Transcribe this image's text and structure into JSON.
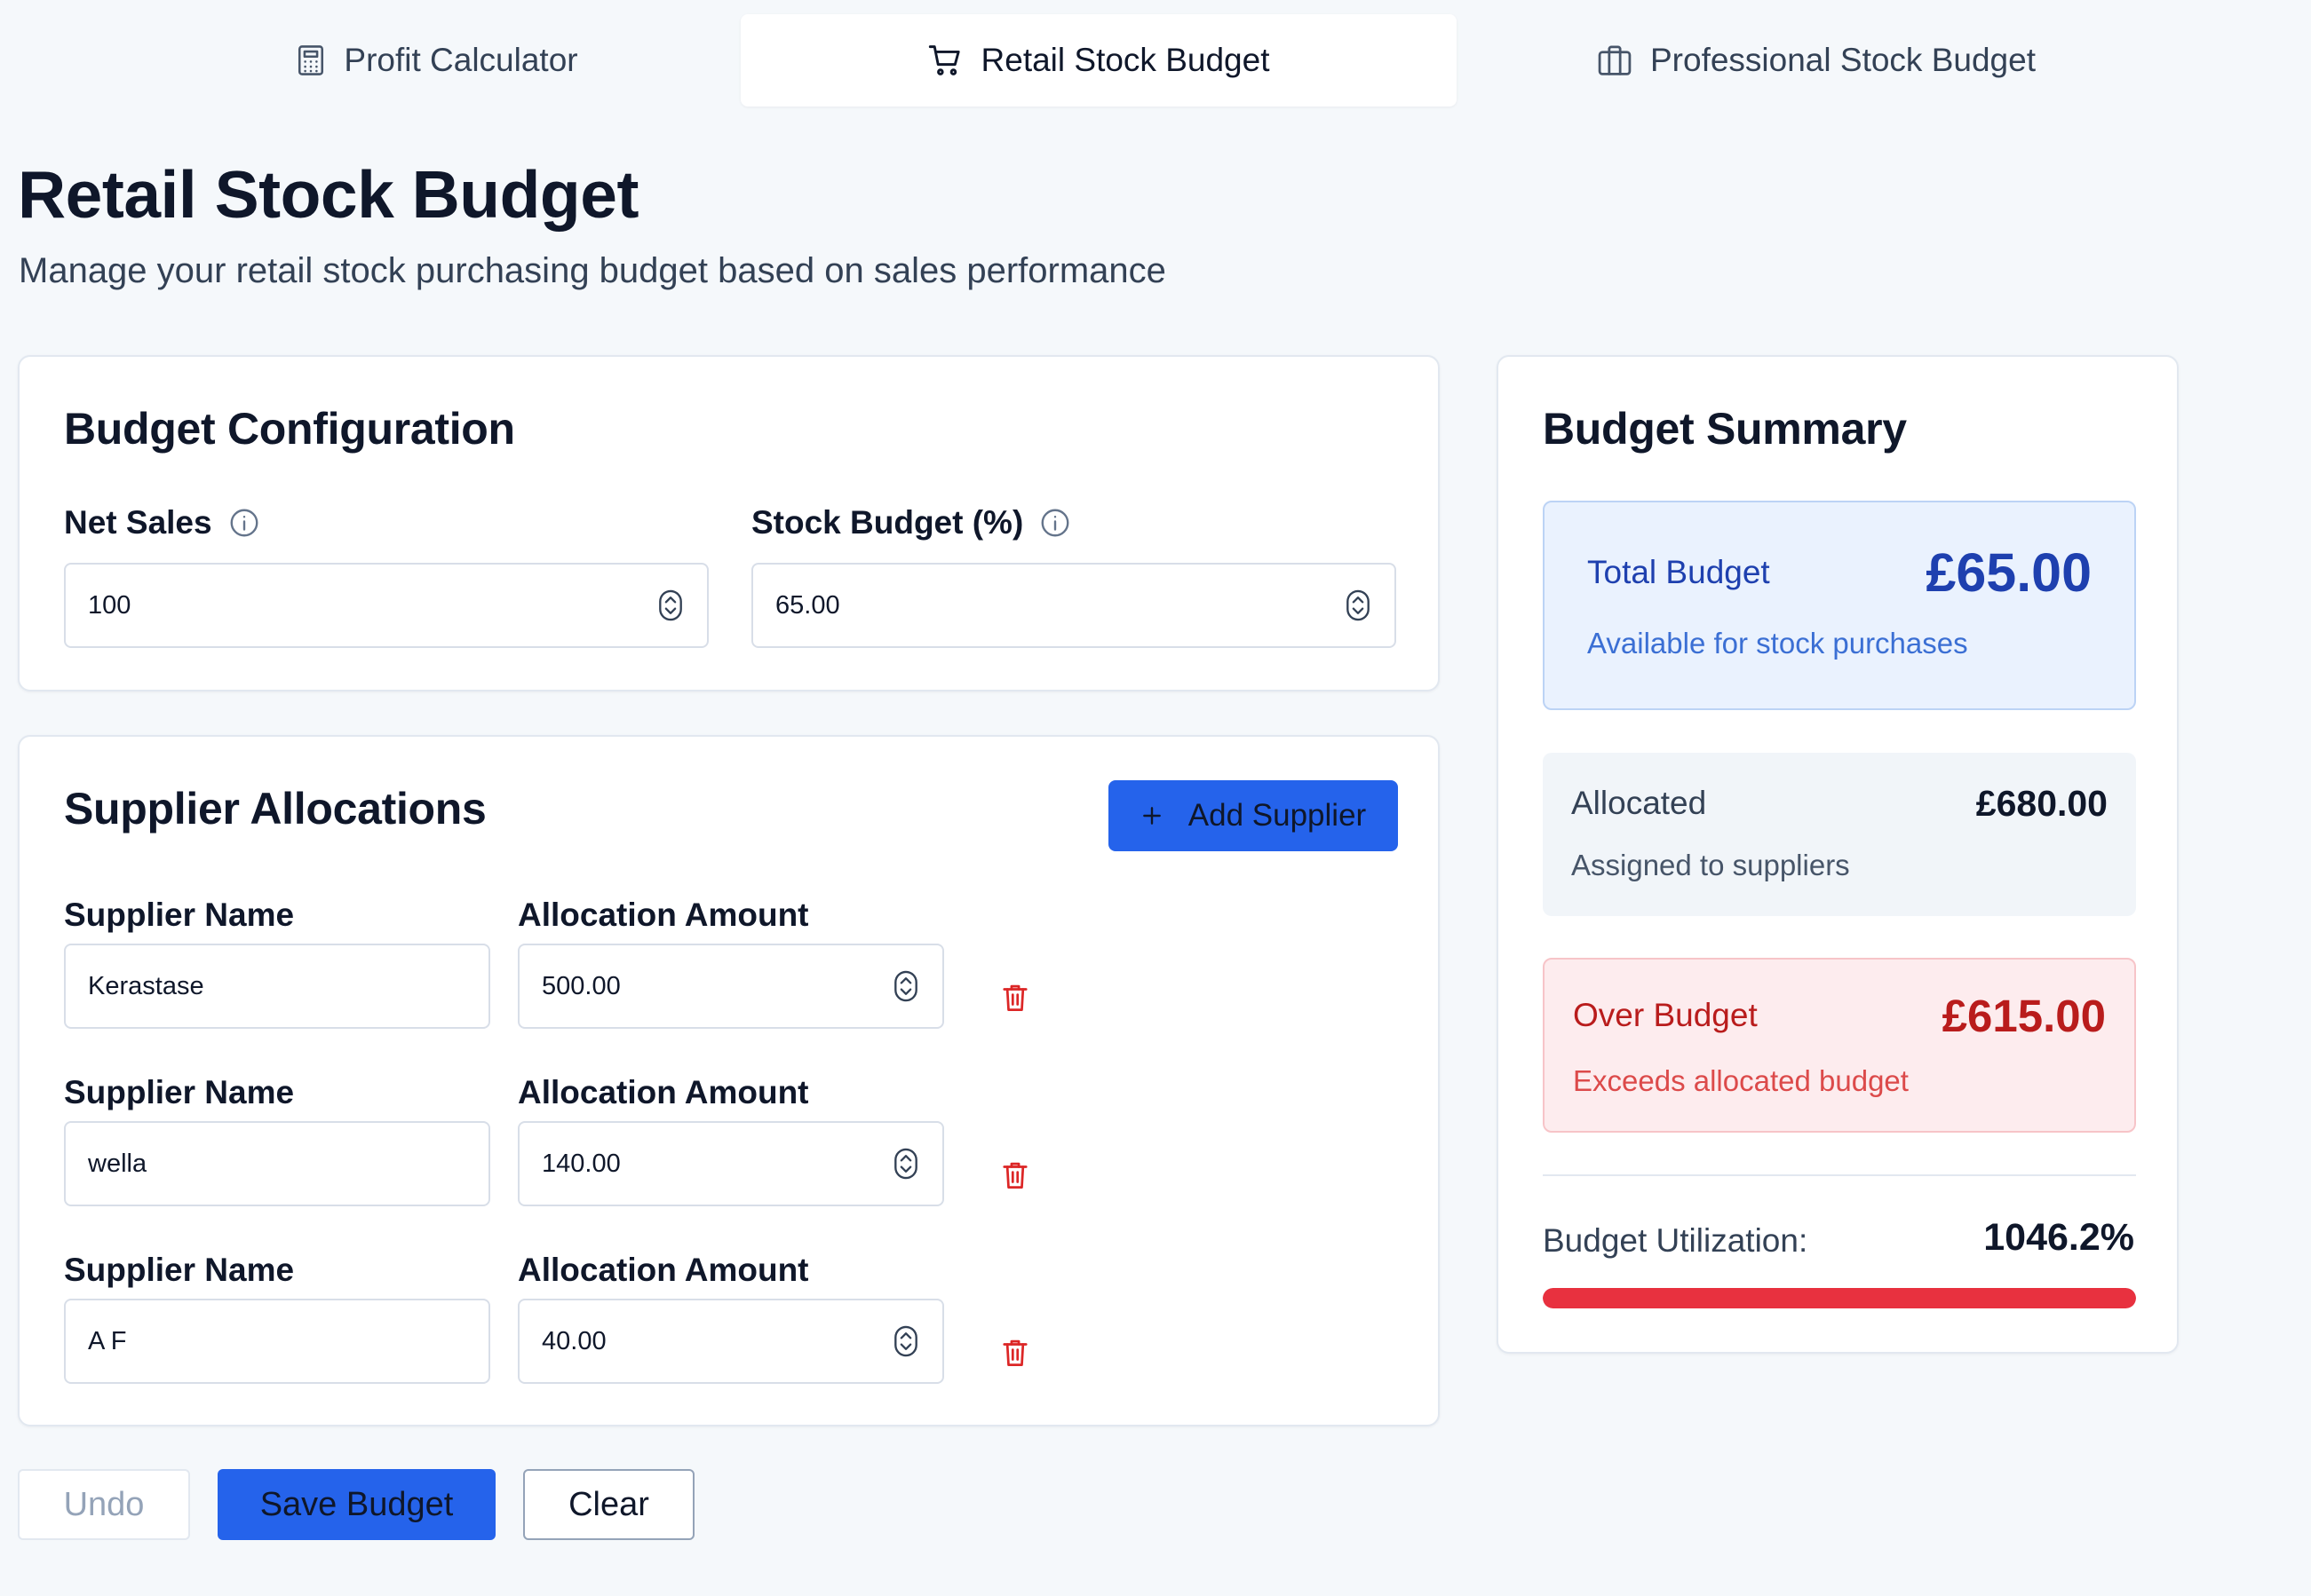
{
  "tabs": [
    {
      "label": "Profit Calculator",
      "icon": "calculator-icon",
      "active": false
    },
    {
      "label": "Retail Stock Budget",
      "icon": "shopping-cart-icon",
      "active": true
    },
    {
      "label": "Professional Stock Budget",
      "icon": "briefcase-icon",
      "active": false
    }
  ],
  "page": {
    "title": "Retail Stock Budget",
    "subtitle": "Manage your retail stock purchasing budget based on sales performance"
  },
  "config": {
    "title": "Budget Configuration",
    "net_sales_label": "Net Sales",
    "net_sales_value": "100",
    "stock_budget_label": "Stock Budget (%)",
    "stock_budget_value": "65.00"
  },
  "suppliers": {
    "title": "Supplier Allocations",
    "add_label": "Add Supplier",
    "name_label": "Supplier Name",
    "amount_label": "Allocation Amount",
    "rows": [
      {
        "name": "Kerastase",
        "amount": "500.00"
      },
      {
        "name": "wella",
        "amount": "140.00"
      },
      {
        "name": "A F",
        "amount": "40.00"
      }
    ]
  },
  "actions": {
    "undo": "Undo",
    "save": "Save Budget",
    "clear": "Clear"
  },
  "summary": {
    "title": "Budget Summary",
    "total_label": "Total Budget",
    "total_value": "£65.00",
    "total_sub": "Available for stock purchases",
    "allocated_label": "Allocated",
    "allocated_value": "£680.00",
    "allocated_sub": "Assigned to suppliers",
    "over_label": "Over Budget",
    "over_value": "£615.00",
    "over_sub": "Exceeds allocated budget",
    "util_label": "Budget Utilization:",
    "util_value": "1046.2%",
    "util_fill_fraction": 1.0
  },
  "colors": {
    "accent": "#2563eb",
    "total_text": "#1e40af",
    "danger": "#b91c1c",
    "util_bar": "#e8313f"
  }
}
